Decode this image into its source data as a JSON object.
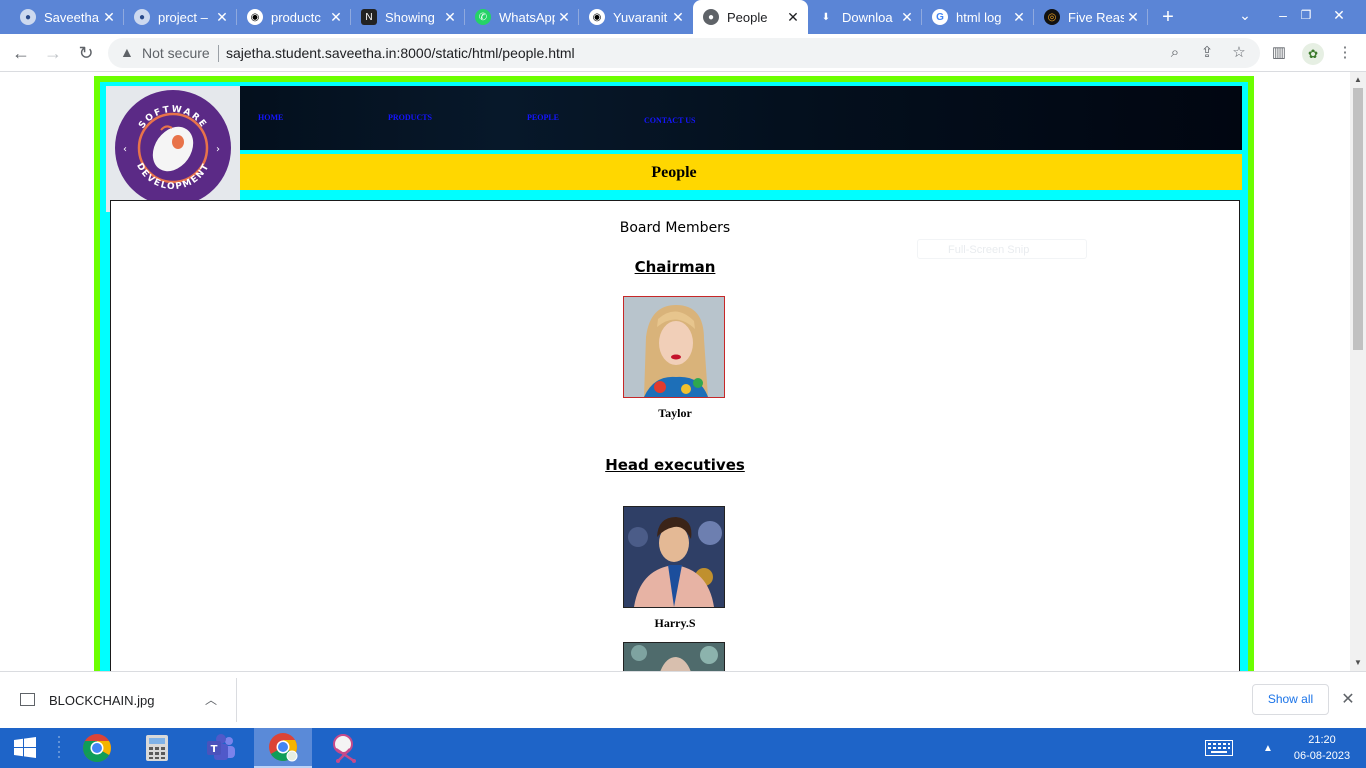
{
  "browser": {
    "tabs": [
      {
        "title": "Saveetha",
        "favicon": "globe-icon"
      },
      {
        "title": "project –",
        "favicon": "globe-icon"
      },
      {
        "title": "productc",
        "favicon": "github-icon"
      },
      {
        "title": "Showing",
        "favicon": "notion-icon"
      },
      {
        "title": "WhatsApp",
        "favicon": "whatsapp-icon"
      },
      {
        "title": "Yuvaranit",
        "favicon": "github-icon"
      },
      {
        "title": "People",
        "favicon": "globe-icon"
      },
      {
        "title": "Downloa",
        "favicon": "download-icon"
      },
      {
        "title": "html log",
        "favicon": "google-icon"
      },
      {
        "title": "Five Reas",
        "favicon": "site-icon"
      }
    ],
    "active_tab_index": 6,
    "security_label": "Not secure",
    "url": "sajetha.student.saveetha.in:8000/static/html/people.html"
  },
  "page": {
    "nav": [
      "HOME",
      "PRODUCTS",
      "PEOPLE",
      "CONTACT US"
    ],
    "logo_text_top": "SOFTWARE",
    "logo_text_bottom": "DEVELOPMENT",
    "banner_title": "People",
    "section_title": "Board Members",
    "chairman_heading": "Chairman",
    "chairman_name": "Taylor",
    "executives_heading": "Head executives",
    "executive_name": "Harry.S",
    "overlay_hint": "Full-Screen Snip"
  },
  "downloads": {
    "file_name": "BLOCKCHAIN.jpg",
    "show_all_label": "Show all"
  },
  "taskbar": {
    "apps": [
      "chrome-icon",
      "calculator-icon",
      "teams-icon",
      "chrome-active-icon",
      "snipping-tool-icon"
    ],
    "time": "21:20",
    "date": "06-08-2023"
  },
  "colors": {
    "tabstrip": "#5b85d6",
    "page_outer_border": "#6cff00",
    "page_inner_border": "#00ffff",
    "banner": "#ffd700",
    "nav_link": "#1515ff",
    "taskbar": "#1e64c8"
  }
}
